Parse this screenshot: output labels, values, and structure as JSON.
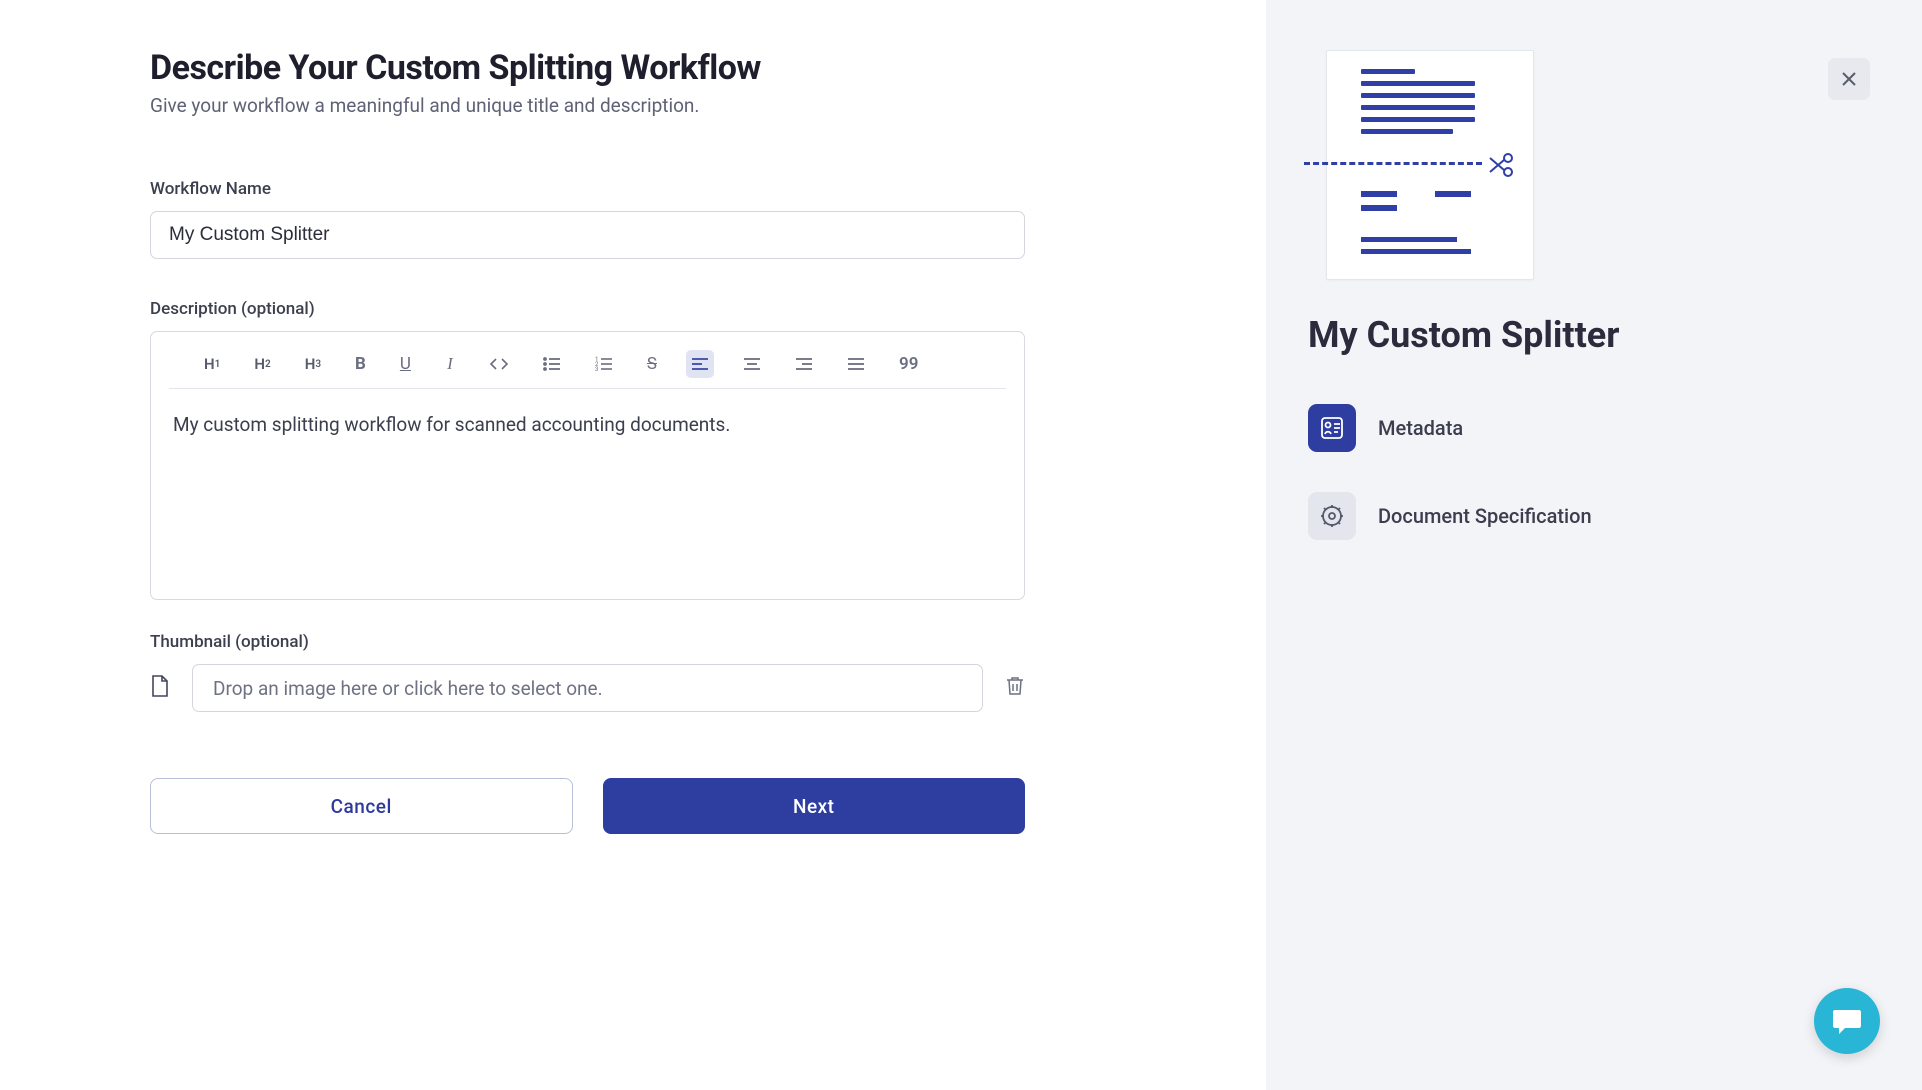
{
  "header": {
    "title": "Describe Your Custom Splitting Workflow",
    "subtitle": "Give your workflow a meaningful and unique title and description."
  },
  "form": {
    "workflow_name_label": "Workflow Name",
    "workflow_name_value": "My Custom Splitter",
    "description_label": "Description (optional)",
    "description_value": "My custom splitting workflow for scanned accounting documents.",
    "thumbnail_label": "Thumbnail (optional)",
    "thumbnail_placeholder": "Drop an image here or click here to select one."
  },
  "toolbar": {
    "h1": "H",
    "h2": "H",
    "h3": "H"
  },
  "buttons": {
    "cancel": "Cancel",
    "next": "Next"
  },
  "side": {
    "title": "My Custom Splitter",
    "step1": "Metadata",
    "step2": "Document Specification"
  }
}
